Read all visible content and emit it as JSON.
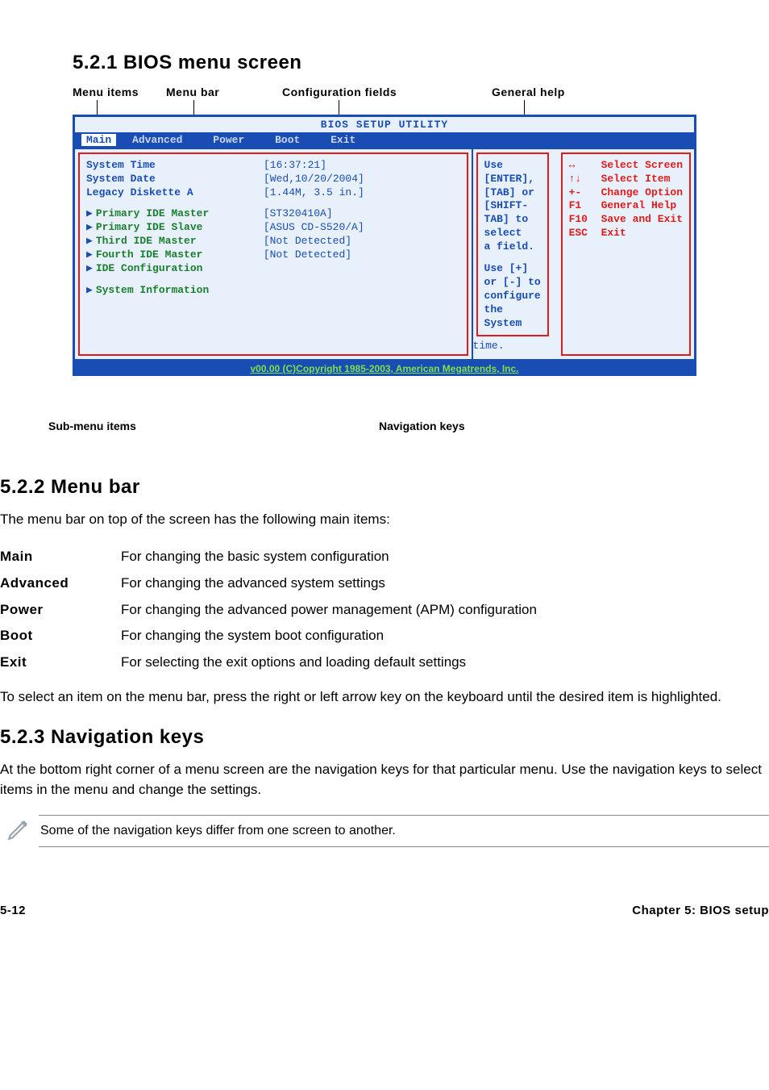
{
  "section521": {
    "heading": "5.2.1   BIOS menu screen",
    "topLabels": {
      "menuItems": "Menu items",
      "menuBar": "Menu bar",
      "configFields": "Configuration fields",
      "generalHelp": "General help"
    },
    "bios": {
      "title": "BIOS SETUP UTILITY",
      "tabs": {
        "main": "Main",
        "advanced": "Advanced",
        "power": "Power",
        "boot": "Boot",
        "exit": "Exit"
      },
      "left": {
        "rows": [
          {
            "label": "System Time",
            "value": "[16:37:21]"
          },
          {
            "label": "System Date",
            "value": "[Wed,10/20/2004]"
          },
          {
            "label": "Legacy Diskette A",
            "value": "[1.44M, 3.5 in.]"
          }
        ],
        "submenu": [
          {
            "label": "Primary IDE Master",
            "value": "[ST320410A]"
          },
          {
            "label": "Primary IDE Slave",
            "value": "[ASUS CD-S520/A]"
          },
          {
            "label": "Third IDE Master",
            "value": "[Not Detected]"
          },
          {
            "label": "Fourth IDE Master",
            "value": "[Not Detected]"
          },
          {
            "label": "IDE Configuration",
            "value": ""
          }
        ],
        "lastSubmenu": {
          "label": "System Information",
          "value": ""
        }
      },
      "rightHelp": {
        "l1": "Use [ENTER], [TAB] or",
        "l2": "[SHIFT-TAB] to select",
        "l3": "a field.",
        "l4": "Use [+] or [-] to",
        "l5": "configure the System",
        "l6": "time."
      },
      "nav": [
        {
          "key": "↔",
          "label": "Select Screen"
        },
        {
          "key": "↑↓",
          "label": "Select Item"
        },
        {
          "key": "+-",
          "label": "Change Option"
        },
        {
          "key": "F1",
          "label": "General Help"
        },
        {
          "key": "F10",
          "label": "Save and Exit"
        },
        {
          "key": "ESC",
          "label": "Exit"
        }
      ],
      "footer": "v00.00 (C)Copyright 1985-2003, American Megatrends, Inc."
    },
    "bottomLabels": {
      "submenu": "Sub-menu items",
      "navkeys": "Navigation keys"
    }
  },
  "section522": {
    "heading": "5.2.2   Menu bar",
    "intro": "The menu bar on top of the screen has the following main items:",
    "items": [
      {
        "k": "Main",
        "v": "For changing the basic system configuration"
      },
      {
        "k": "Advanced",
        "v": "For changing the advanced system settings"
      },
      {
        "k": "Power",
        "v": "For changing the advanced power management (APM) configuration"
      },
      {
        "k": "Boot",
        "v": "For changing the system boot configuration"
      },
      {
        "k": "Exit",
        "v": "For selecting the exit options and loading default settings"
      }
    ],
    "outro": "To select an item on the menu bar, press the right or left arrow key on the keyboard until the desired item is highlighted."
  },
  "section523": {
    "heading": "5.2.3   Navigation keys",
    "para": "At the bottom right corner of a menu screen are the navigation keys for that particular menu. Use the navigation keys to select items in the menu and change the settings.",
    "note": "Some of the navigation keys differ from one screen to another."
  },
  "footer": {
    "left": "5-12",
    "right": "Chapter 5: BIOS setup"
  }
}
